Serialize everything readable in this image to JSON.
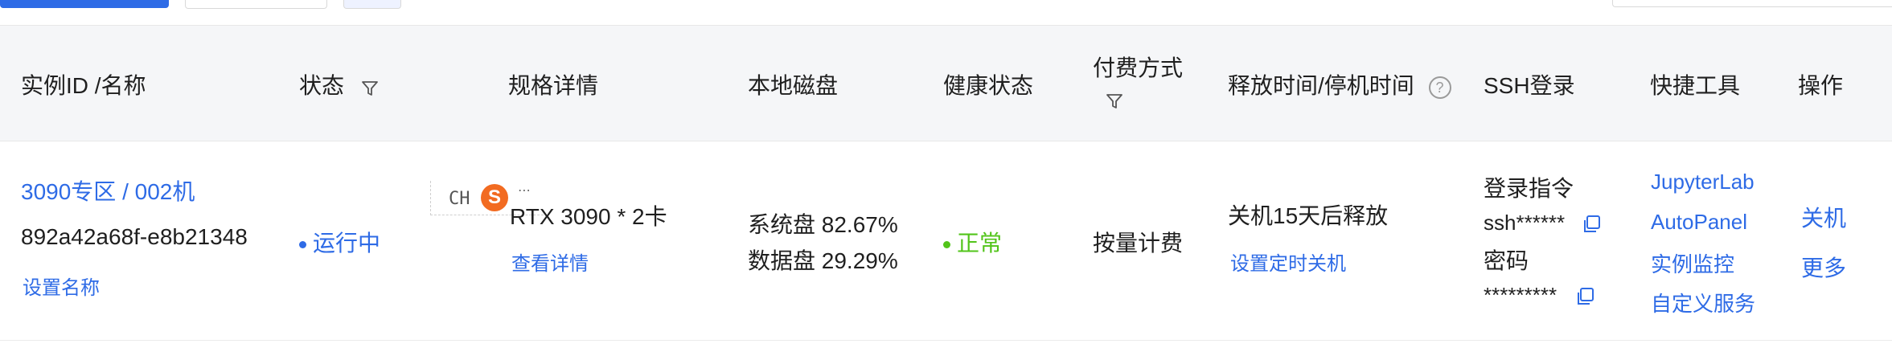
{
  "table": {
    "headers": {
      "instance": "实例ID /名称",
      "status": "状态",
      "spec": "规格详情",
      "disk": "本地磁盘",
      "health": "健康状态",
      "billing": "付费方式",
      "release": "释放时间/停机时间",
      "ssh": "SSH登录",
      "tools": "快捷工具",
      "actions": "操作"
    },
    "rows": [
      {
        "name": "3090专区 / 002机",
        "id": "892a42a68f-e8b21348",
        "set_name": "设置名称",
        "status": "运行中",
        "spec": "RTX 3090 * 2卡",
        "spec_detail": "查看详情",
        "system_disk": "系统盘 82.67%",
        "data_disk": "数据盘 29.29%",
        "health": "正常",
        "billing": "按量计费",
        "release": "关机15天后释放",
        "set_timer": "设置定时关机",
        "login_cmd_label": "登录指令",
        "login_cmd": "ssh******",
        "password_label": "密码",
        "password": "*********",
        "tools": [
          "JupyterLab",
          "AutoPanel",
          "实例监控",
          "自定义服务"
        ],
        "action_shutdown": "关机",
        "action_more": "更多"
      }
    ]
  },
  "ime": {
    "mode": "CH",
    "logo": "S",
    "more": "⋯"
  },
  "colors": {
    "primary": "#2e6be6",
    "success": "#52c41a",
    "header_bg": "#f5f6f8"
  },
  "icons": [
    "filter-icon",
    "help-icon",
    "copy-icon",
    "status-dot-icon"
  ]
}
